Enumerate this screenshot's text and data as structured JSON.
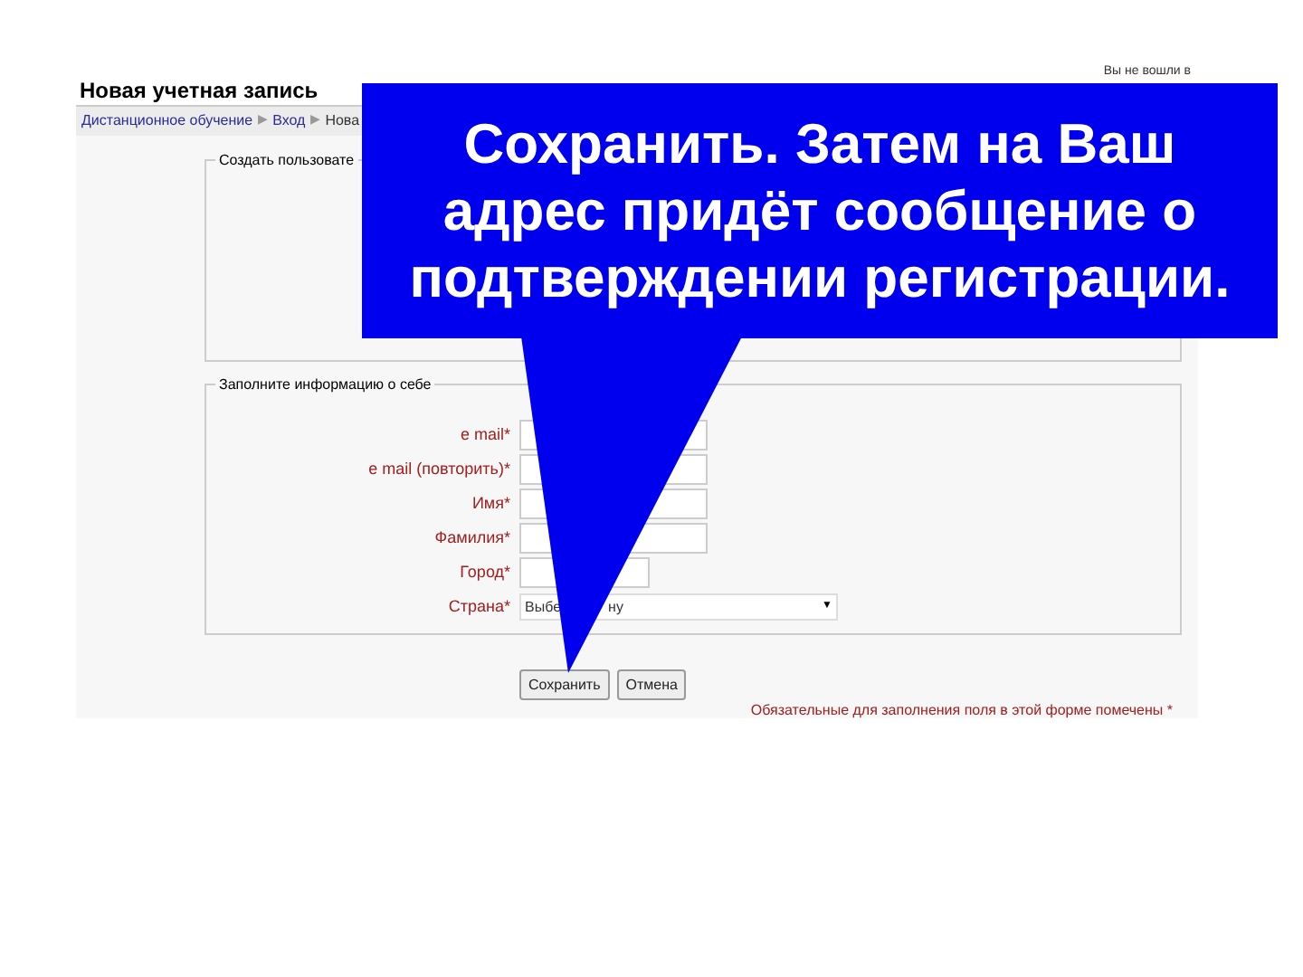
{
  "page": {
    "title": "Новая учетная запись",
    "login_info": "Вы не вошли в",
    "breadcrumb": [
      {
        "label": "Дистанционное обучение",
        "separator": "▶"
      },
      {
        "label": "Вход",
        "separator": "▶"
      },
      {
        "label": "Нова"
      }
    ]
  },
  "fieldsets": [
    {
      "legend": "Создать пользовате"
    },
    {
      "legend": "Заполните информацию о себе",
      "fields": [
        {
          "label": "e mail*",
          "kind": "long-text"
        },
        {
          "label": "e mail (повторить)*",
          "kind": "long-text"
        },
        {
          "label": "Имя*",
          "kind": "long-text"
        },
        {
          "label": "Фамилия*",
          "kind": "long-text"
        },
        {
          "label": "Город*",
          "kind": "short-text"
        },
        {
          "label": "Страна*",
          "kind": "select",
          "value_start": "Выбе",
          "value_end": "ну",
          "caret": "▼"
        }
      ]
    }
  ],
  "buttons": [
    "Сохранить",
    "Отмена"
  ],
  "required_note": "Обязательные для заполнения поля в этой форме помечены *",
  "callout": {
    "text": "Сохранить. Затем на Ваш адрес придёт сообщение о подтверждении регистрации."
  }
}
